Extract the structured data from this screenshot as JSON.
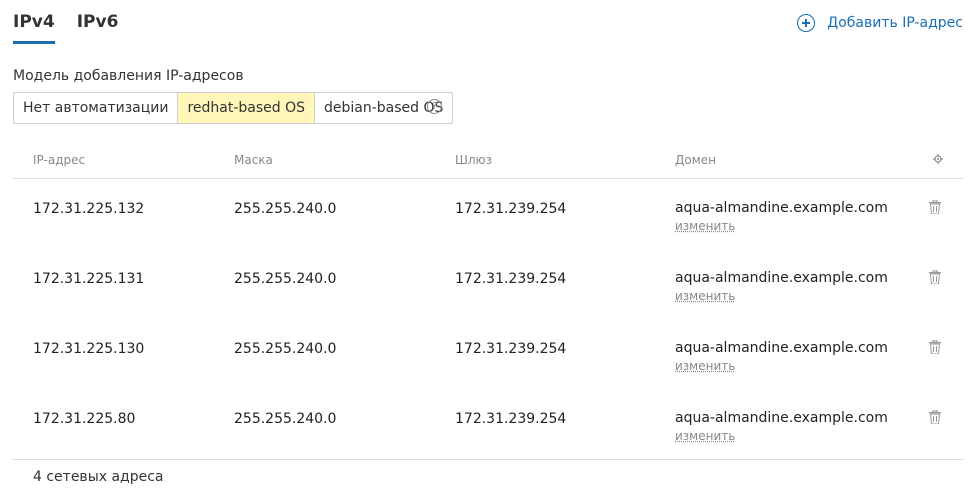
{
  "tabs": [
    {
      "label": "IPv4",
      "active": true
    },
    {
      "label": "IPv6",
      "active": false
    }
  ],
  "add_button": {
    "label": "Добавить IP-адрес",
    "icon": "plus-circle-icon"
  },
  "model": {
    "label": "Модель добавления IP-адресов",
    "options": [
      "Нет автоматизации",
      "redhat-based OS",
      "debian-based OS"
    ],
    "selected": "redhat-based OS",
    "help_icon": "?"
  },
  "table": {
    "headers": {
      "ip": "IP-адрес",
      "mask": "Маска",
      "gateway": "Шлюз",
      "domain": "Домен"
    },
    "change_label": "изменить",
    "rows": [
      {
        "ip": "172.31.225.132",
        "mask": "255.255.240.0",
        "gateway": "172.31.239.254",
        "domain": "aqua-almandine.example.com"
      },
      {
        "ip": "172.31.225.131",
        "mask": "255.255.240.0",
        "gateway": "172.31.239.254",
        "domain": "aqua-almandine.example.com"
      },
      {
        "ip": "172.31.225.130",
        "mask": "255.255.240.0",
        "gateway": "172.31.239.254",
        "domain": "aqua-almandine.example.com"
      },
      {
        "ip": "172.31.225.80",
        "mask": "255.255.240.0",
        "gateway": "172.31.239.254",
        "domain": "aqua-almandine.example.com"
      }
    ]
  },
  "footer": {
    "count_text": "4 сетевых адреса"
  },
  "colors": {
    "accent": "#1a6fb5",
    "selected_bg": "#fff6b8",
    "muted": "#888888"
  }
}
